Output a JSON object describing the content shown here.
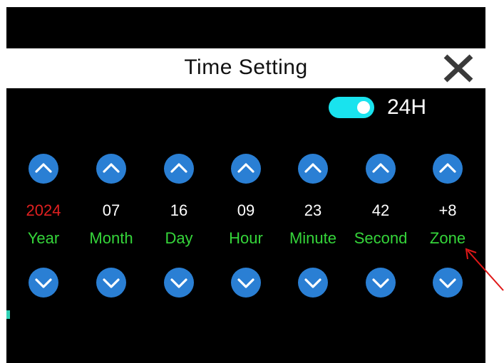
{
  "header": {
    "title": "Time Setting"
  },
  "toggle": {
    "label": "24H",
    "on": true,
    "color": "#19e3ee"
  },
  "colors": {
    "button": "#2a7fd4",
    "label": "#35d53a",
    "highlight_value": "#e02020",
    "value": "#ffffff"
  },
  "columns": [
    {
      "label": "Year",
      "value": "2024"
    },
    {
      "label": "Month",
      "value": "07"
    },
    {
      "label": "Day",
      "value": "16"
    },
    {
      "label": "Hour",
      "value": "09"
    },
    {
      "label": "Minute",
      "value": "23"
    },
    {
      "label": "Second",
      "value": "42"
    },
    {
      "label": "Zone",
      "value": "+8"
    }
  ],
  "icons": {
    "up": "chevron-up-icon",
    "down": "chevron-down-icon",
    "close": "close-icon"
  }
}
